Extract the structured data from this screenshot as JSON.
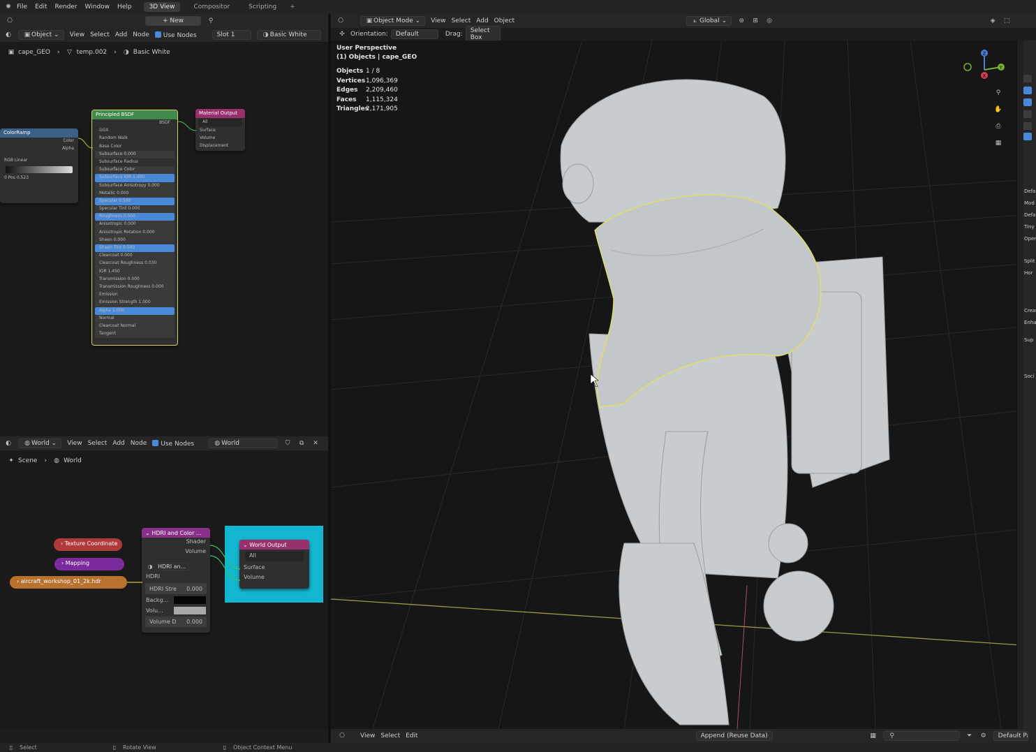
{
  "menubar": {
    "menus": [
      "File",
      "Edit",
      "Render",
      "Window",
      "Help"
    ],
    "workspace_tabs": [
      "3D View",
      "Compositor",
      "Scripting"
    ],
    "add_tab": "+"
  },
  "shader_editor": {
    "header": {
      "object_mode": "Object",
      "menus": [
        "View",
        "Select",
        "Add",
        "Node"
      ],
      "use_nodes": "Use Nodes",
      "slot": "Slot 1",
      "material": "Basic White",
      "new_label": "New"
    },
    "breadcrumb": [
      "cape_GEO",
      "temp.002",
      "Basic White"
    ],
    "nodes": {
      "colorramp": {
        "title": "ColorRamp",
        "rows": [
          "Color",
          "Alpha",
          "RGB   Linear",
          "0   Pos   0.523"
        ]
      },
      "bsdf": {
        "title": "Principled BSDF",
        "rows": [
          "BSDF",
          "GGX",
          "Random Walk",
          "Base Color",
          "Subsurface 0.000",
          "Subsurface Radius",
          "Subsurface Color",
          "Subsurface IOR 1.400",
          "Subsurface Anisotropy 0.000",
          "Metallic 0.000",
          "Specular 0.500",
          "Specular Tint 0.000",
          "Roughness 0.500",
          "Anisotropic 0.000",
          "Anisotropic Rotation 0.000",
          "Sheen 0.000",
          "Sheen Tint 0.500",
          "Clearcoat 0.000",
          "Clearcoat Roughness 0.030",
          "IOR 1.450",
          "Transmission 0.000",
          "Transmission Roughness 0.000",
          "Emission",
          "Emission Strength 1.000",
          "Alpha 1.000",
          "Normal",
          "Clearcoat Normal",
          "Tangent"
        ]
      },
      "material_output": {
        "title": "Material Output",
        "rows": [
          "All",
          "Surface",
          "Volume",
          "Displacement"
        ]
      }
    }
  },
  "world_editor": {
    "header": {
      "mode": "World",
      "menus": [
        "View",
        "Select",
        "Add",
        "Node"
      ],
      "use_nodes": "Use Nodes",
      "world": "World"
    },
    "breadcrumb": [
      "Scene",
      "World"
    ],
    "nodes": {
      "texture_coordinate": "Texture Coordinate",
      "mapping": "Mapping",
      "image": "aircraft_workshop_01_2k.hdr",
      "hdri": {
        "title": "HDRI and Color ...",
        "shader": "Shader",
        "volume": "Volume",
        "selector": "HDRI an...",
        "hdri": "HDRI",
        "strength_label": "HDRI Stre",
        "strength_value": "0.000",
        "background": "Backg...",
        "volume_in": "Volu...",
        "volume_d_label": "Volume D",
        "volume_d_value": "0.000"
      },
      "world_output": {
        "title": "World Output",
        "target": "All",
        "surface": "Surface",
        "volume": "Volume"
      }
    }
  },
  "viewport": {
    "header": {
      "mode": "Object Mode",
      "menus": [
        "View",
        "Select",
        "Add",
        "Object"
      ],
      "transform": "Global"
    },
    "tool_header": {
      "orientation_label": "Orientation:",
      "orientation": "Default",
      "drag_label": "Drag:",
      "drag": "Select Box"
    },
    "overlay": {
      "perspective": "User Perspective",
      "collection": "(1) Objects | cape_GEO"
    },
    "stats": [
      {
        "key": "Objects",
        "value": "1 / 8"
      },
      {
        "key": "Vertices",
        "value": "1,096,369"
      },
      {
        "key": "Edges",
        "value": "2,209,460"
      },
      {
        "key": "Faces",
        "value": "1,115,324"
      },
      {
        "key": "Triangles",
        "value": "2,171,905"
      }
    ],
    "gizmo": {
      "z": "Z",
      "y": "Y",
      "x": "X"
    }
  },
  "side_panel_labels": [
    "Defa",
    "Mod",
    "Defa",
    "Tiny",
    "Oper",
    "Split",
    "Hor",
    "Creat",
    "Enha",
    "Sup",
    "Soci"
  ],
  "asset_bar": {
    "menus": [
      "View",
      "Select",
      "Edit"
    ],
    "import": "Append (Reuse Data)",
    "filter": "Default Param"
  },
  "statusbar": {
    "select": "Select",
    "rotate": "Rotate View",
    "context": "Object Context Menu"
  },
  "colors": {
    "accent": "#4a88d8",
    "selection": "#e3e05a",
    "world_output_bg": "#13b6cf"
  }
}
